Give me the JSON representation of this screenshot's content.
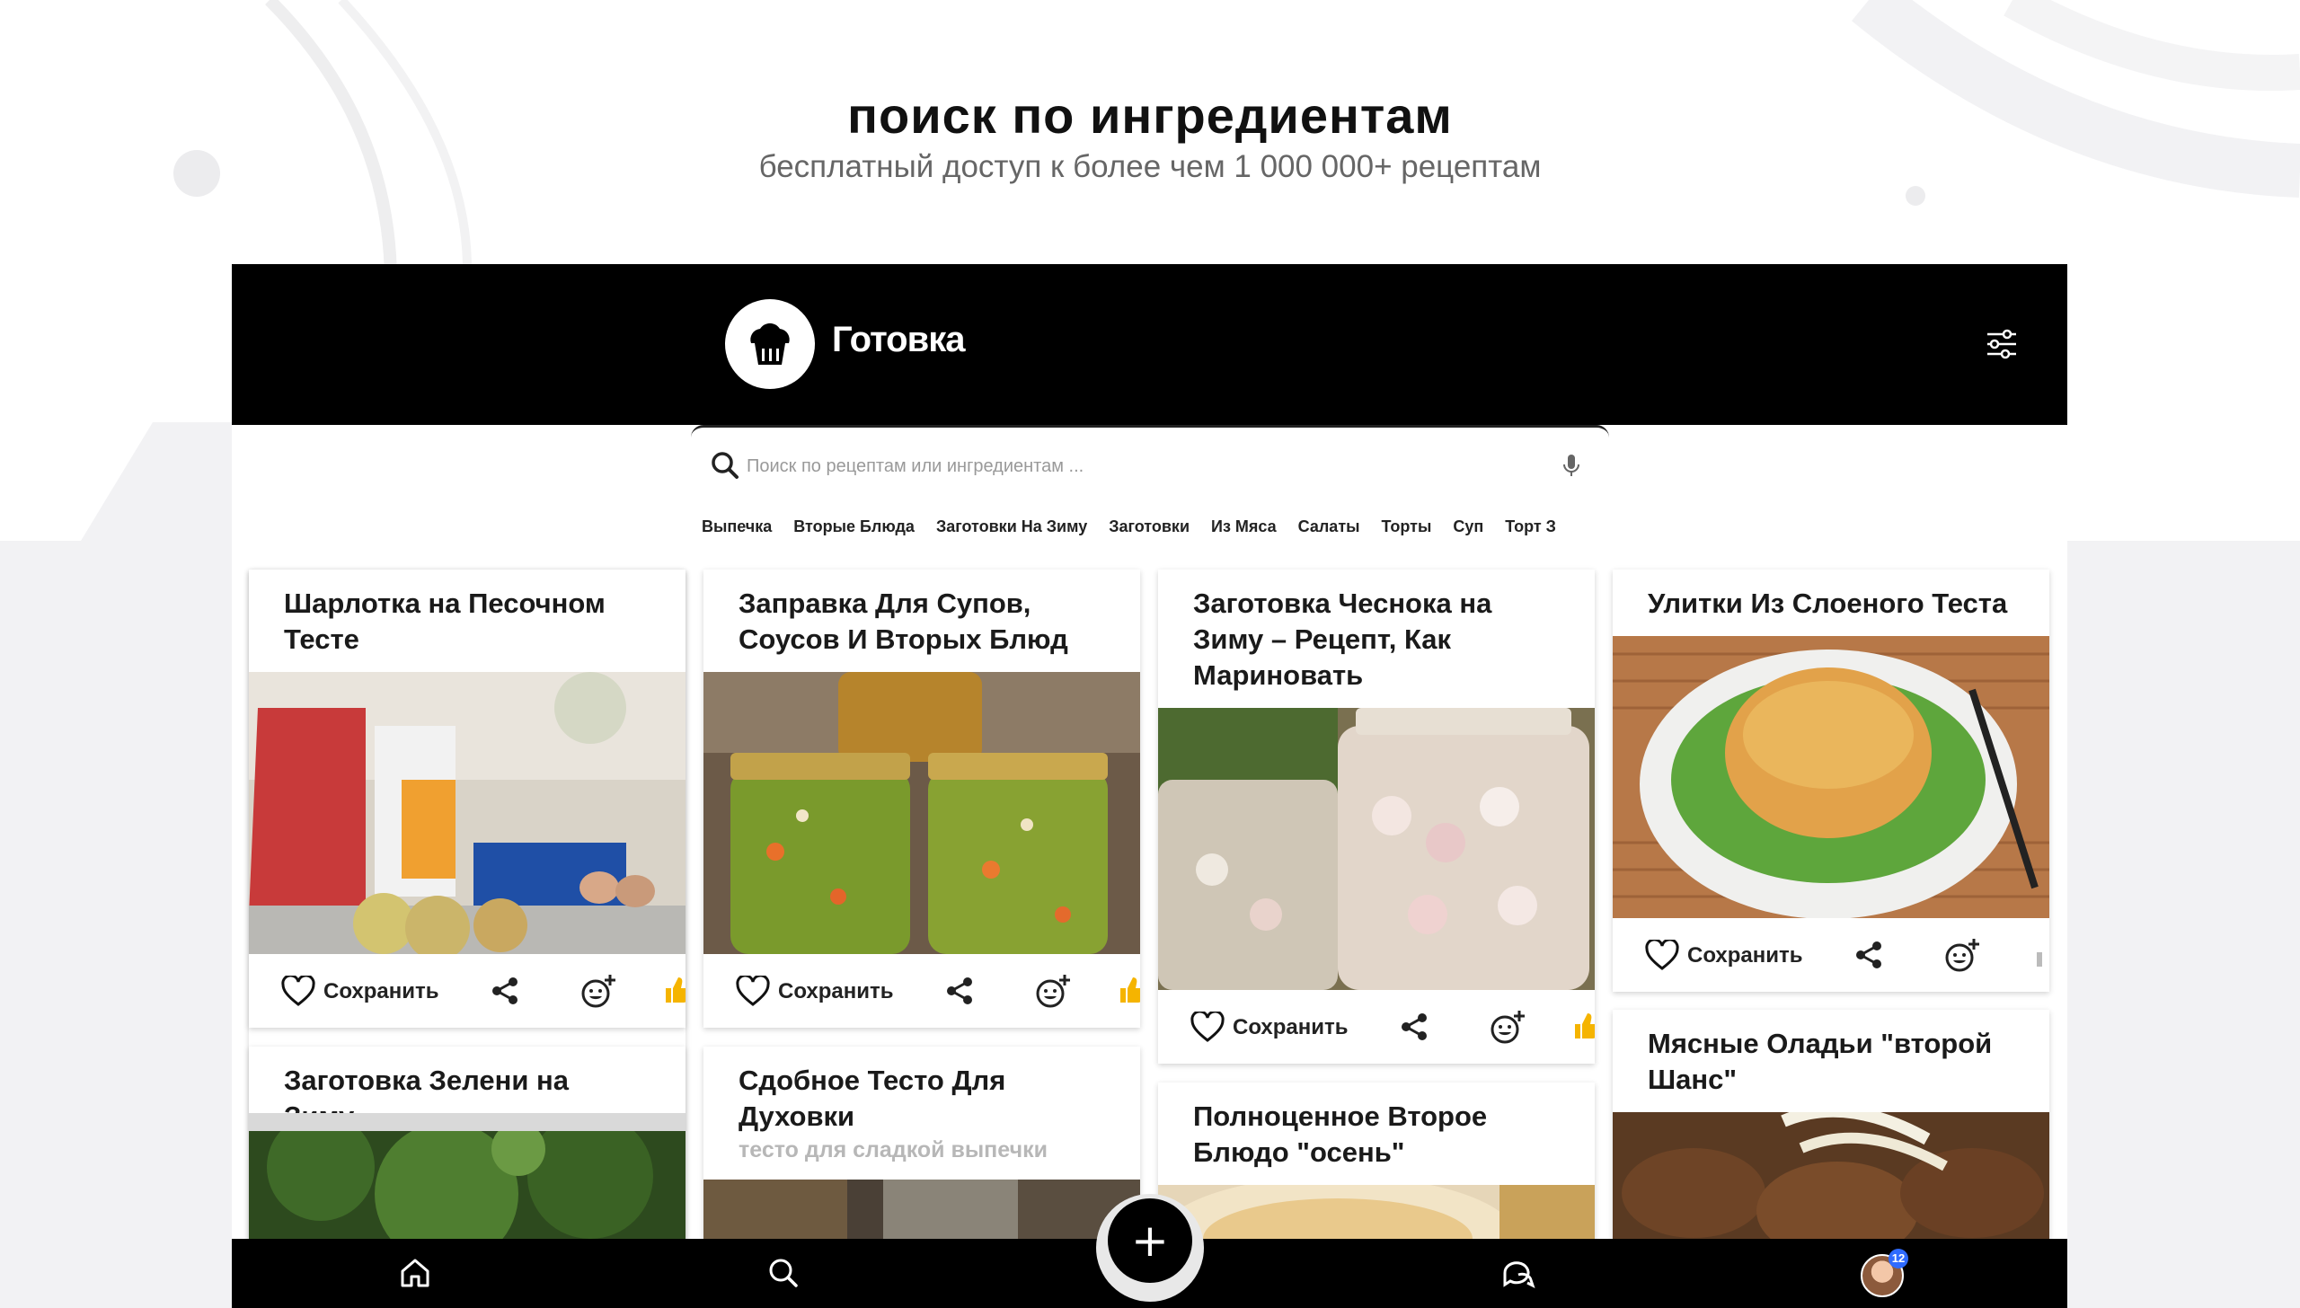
{
  "promo": {
    "headline": "поиск по ингредиентам",
    "subheadline": "бесплатный доступ к более чем 1 000 000+ рецептам"
  },
  "app": {
    "title": "Готовка",
    "logo_icon": "chef-hat-icon",
    "filter_icon": "sliders-icon"
  },
  "search": {
    "placeholder": "Поиск по рецептам или ингредиентам ...",
    "value": ""
  },
  "categories": [
    "Выпечка",
    "Вторые Блюда",
    "Заготовки На Зиму",
    "Заготовки",
    "Из Мяса",
    "Салаты",
    "Торты",
    "Суп",
    "Торт З"
  ],
  "actions": {
    "save_label": "Сохранить"
  },
  "recipes": [
    {
      "title": "Шарлотка на Песочном Тесте",
      "subtitle": ""
    },
    {
      "title": "Заправка Для Супов, Соусов И Вторых Блюд",
      "subtitle": ""
    },
    {
      "title": "Заготовка Чеснока на Зиму – Рецепт, Как Мариновать",
      "subtitle": ""
    },
    {
      "title": "Улитки Из Слоеного Теста",
      "subtitle": ""
    },
    {
      "title": "Заготовка Зелени на Зиму.",
      "subtitle": ""
    },
    {
      "title": "Сдобное Тесто Для Духовки",
      "subtitle": "тесто для сладкой выпечки"
    },
    {
      "title": "Полноценное Второе Блюдо \"осень\"",
      "subtitle": ""
    },
    {
      "title": "Мясные Оладьи \"второй Шанс\"",
      "subtitle": ""
    }
  ],
  "bottom_nav": {
    "items": [
      "home-icon",
      "search-icon",
      "add-icon",
      "chat-icon",
      "avatar"
    ],
    "fab_symbol": "+",
    "notifications_badge": "12"
  },
  "colors": {
    "bar": "#000000",
    "badge": "#2f6bff",
    "accent_like": "#f5b400"
  }
}
